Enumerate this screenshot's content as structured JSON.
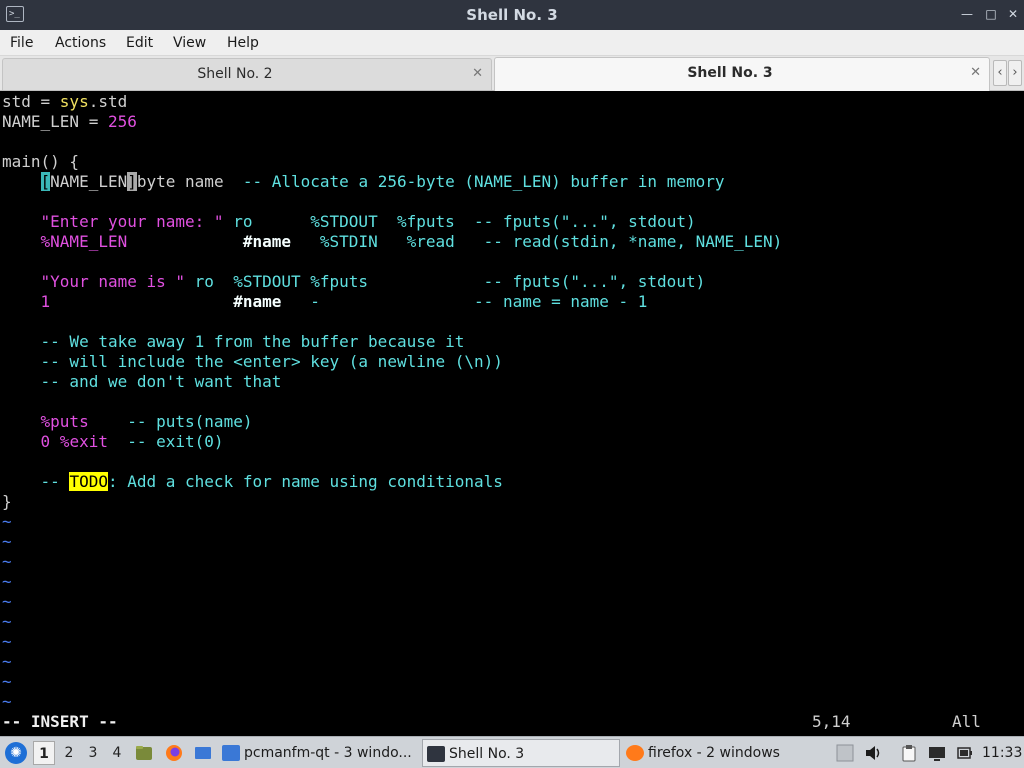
{
  "window": {
    "title": "Shell No. 3",
    "icon_name": "terminal-icon",
    "controls": {
      "minimize": "—",
      "maximize": "□",
      "close": "✕"
    }
  },
  "menubar": {
    "items": [
      "File",
      "Actions",
      "Edit",
      "View",
      "Help"
    ]
  },
  "tabs": [
    {
      "label": "Shell No. 2",
      "active": false,
      "close": "✕"
    },
    {
      "label": "Shell No. 3",
      "active": true,
      "close": "✕"
    }
  ],
  "tab_scroll": {
    "left": "‹",
    "right": "›"
  },
  "editor": {
    "line1": {
      "a": "std = ",
      "b": "sys",
      "c": ".std"
    },
    "line2": {
      "a": "NAME_LEN = ",
      "b": "256"
    },
    "line4": {
      "a": "main() {"
    },
    "line5": {
      "indent": "    ",
      "cur_l": "[",
      "name": "NAME_LEN",
      "cur_r": "]",
      "rest": "byte name  ",
      "comment": "-- Allocate a 256-byte (NAME_LEN) buffer in memory"
    },
    "line7": {
      "str": "\"Enter your name: \"",
      "ro": " ro      ",
      "out": "%STDOUT  ",
      "fn": "%fputs  ",
      "comment": "-- fputs(\"...\", stdout)"
    },
    "line8": {
      "len": "%NAME_LEN",
      "gap": "            ",
      "ref": "#name",
      "gap2": "   ",
      "inp": "%STDIN   ",
      "fn": "%read   ",
      "comment": "-- read(stdin, *name, NAME_LEN)"
    },
    "line10": {
      "str": "\"Your name is \"",
      "ro": " ro  ",
      "out": "%STDOUT ",
      "fn": "%fputs            ",
      "comment": "-- fputs(\"...\", stdout)"
    },
    "line11": {
      "num": "1",
      "gap": "                   ",
      "ref": "#name",
      "gap2": "   ",
      "op": "-                ",
      "comment": "-- name = name - 1"
    },
    "line13": "-- We take away 1 from the buffer because it",
    "line14": "-- will include the <enter> key (a newline (\\n))",
    "line15": "-- and we don't want that",
    "line17": {
      "fn": "%puts",
      "comment": "    -- puts(name)"
    },
    "line18": {
      "num": "0",
      "fn": " %exit",
      "comment": "  -- exit(0)"
    },
    "line20": {
      "pre": "-- ",
      "todo": "TODO",
      "post": ": Add a check for name using conditionals"
    },
    "line21": "}",
    "tilde": "~"
  },
  "status": {
    "mode": "-- INSERT --",
    "position": "5,14",
    "scroll": "All"
  },
  "taskbar": {
    "desktops": [
      "1",
      "2",
      "3",
      "4"
    ],
    "tasks": [
      {
        "label": "pcmanfm-qt - 3 windo...",
        "icon": "folder-icon"
      },
      {
        "label": "Shell No. 3",
        "icon": "terminal-icon"
      },
      {
        "label": "firefox - 2 windows",
        "icon": "firefox-icon"
      }
    ],
    "clock": "11:33"
  }
}
